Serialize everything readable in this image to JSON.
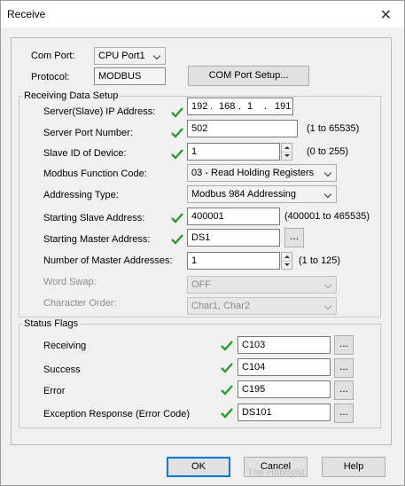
{
  "window": {
    "title": "Receive"
  },
  "com_port": {
    "label": "Com Port:",
    "value": "CPU Port1"
  },
  "protocol": {
    "label": "Protocol:",
    "value": "MODBUS"
  },
  "com_setup_button": "COM Port Setup...",
  "receiving": {
    "group_label": "Receiving Data Setup",
    "ip": {
      "label": "Server(Slave) IP Address:",
      "octets": [
        "192",
        "168",
        "1",
        "191"
      ]
    },
    "port": {
      "label": "Server Port Number:",
      "value": "502",
      "range": "(1 to 65535)"
    },
    "slave_id": {
      "label": "Slave ID of Device:",
      "value": "1",
      "range": "(0 to 255)"
    },
    "function_code": {
      "label": "Modbus Function Code:",
      "value": "03 - Read Holding Registers"
    },
    "addressing": {
      "label": "Addressing Type:",
      "value": "Modbus 984 Addressing"
    },
    "start_slave": {
      "label": "Starting Slave Address:",
      "value": "400001",
      "range": "(400001 to 465535)"
    },
    "start_master": {
      "label": "Starting Master Address:",
      "value": "DS1",
      "browse": "..."
    },
    "num_master": {
      "label": "Number of Master Addresses:",
      "value": "1",
      "range": "(1 to 125)"
    },
    "word_swap": {
      "label": "Word Swap:",
      "value": "OFF"
    },
    "char_order": {
      "label": "Character Order:",
      "value": "Char1, Char2"
    }
  },
  "status": {
    "group_label": "Status Flags",
    "receiving": {
      "label": "Receiving",
      "value": "C103",
      "browse": "..."
    },
    "success": {
      "label": "Success",
      "value": "C104",
      "browse": "..."
    },
    "error": {
      "label": "Error",
      "value": "C195",
      "browse": "..."
    },
    "exception": {
      "label": "Exception Response (Error Code)",
      "value": "DS101",
      "browse": "..."
    }
  },
  "buttons": {
    "ok": "OK",
    "cancel": "Cancel",
    "help": "Help"
  },
  "watermark": "The Hobbyist"
}
